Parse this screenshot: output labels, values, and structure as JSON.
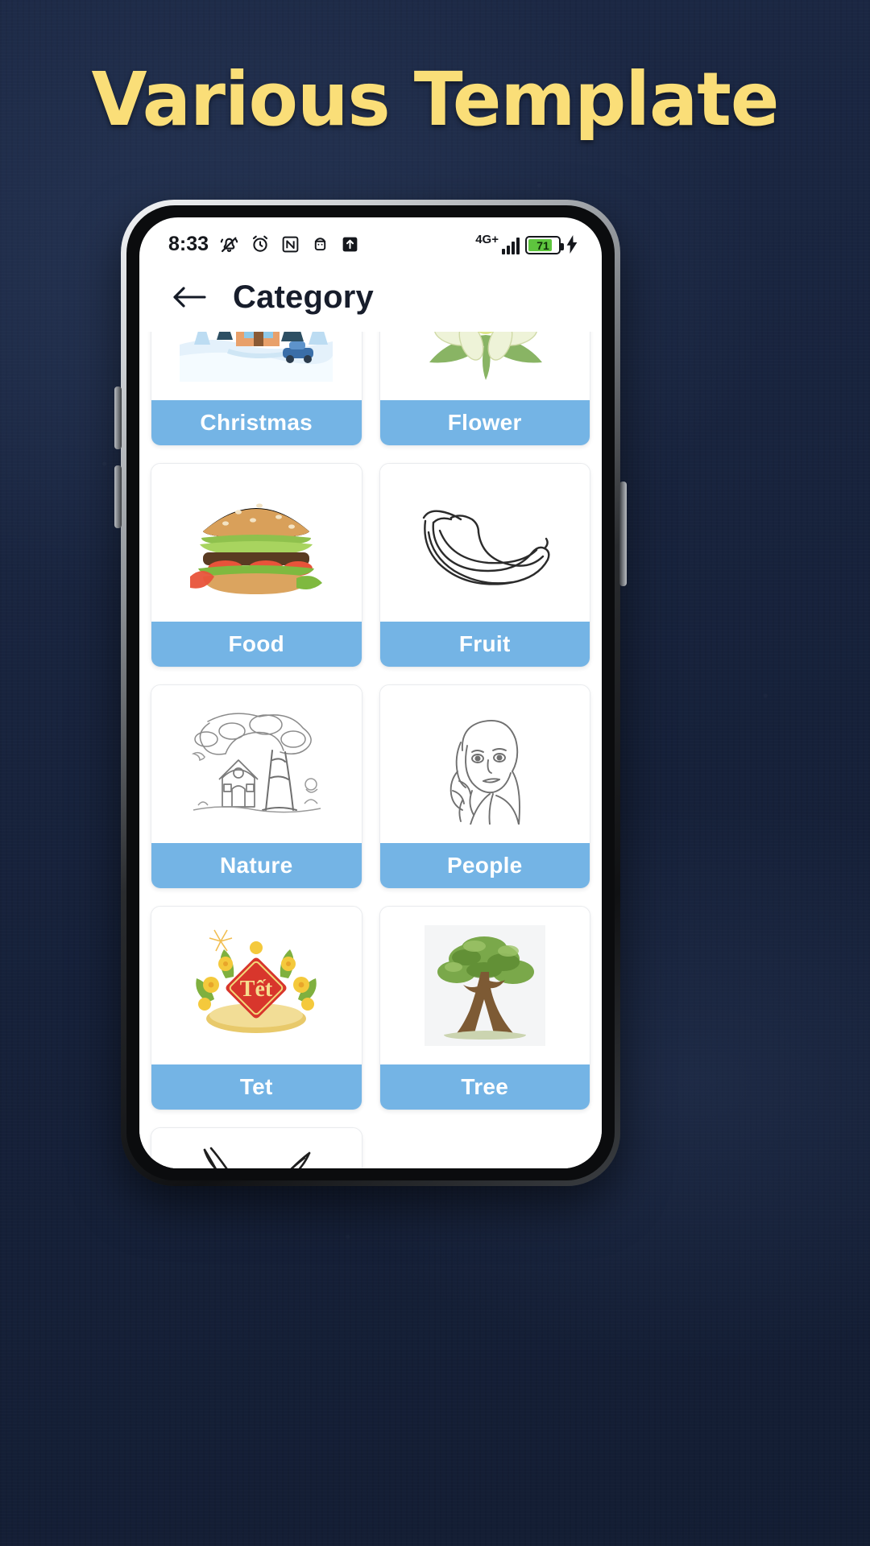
{
  "promo": {
    "headline": "Various Template",
    "headline_color": "#fade78",
    "background_color": "#1b2742"
  },
  "status_bar": {
    "time": "8:33",
    "icons_left": [
      "vibrate-off-icon",
      "alarm-icon",
      "nfc-icon",
      "android-face-icon",
      "upload-arrow-icon"
    ],
    "network_label": "4G+",
    "signal_bars": 4,
    "battery_percent": "71",
    "battery_color": "#5ec53e",
    "charging": true
  },
  "app_bar": {
    "back_icon": "arrow-left-icon",
    "title": "Category"
  },
  "grid": {
    "accent_color": "#74b4e5",
    "items": [
      {
        "label": "Christmas",
        "thumb": "christmas-house-thumb"
      },
      {
        "label": "Flower",
        "thumb": "flower-thumb"
      },
      {
        "label": "Food",
        "thumb": "burger-thumb"
      },
      {
        "label": "Fruit",
        "thumb": "banana-thumb"
      },
      {
        "label": "Nature",
        "thumb": "tree-house-thumb"
      },
      {
        "label": "People",
        "thumb": "portrait-thumb"
      },
      {
        "label": "Tet",
        "thumb": "tet-thumb"
      },
      {
        "label": "Tree",
        "thumb": "bonsai-tree-thumb"
      },
      {
        "label": "",
        "thumb": "pikachu-thumb"
      }
    ]
  }
}
